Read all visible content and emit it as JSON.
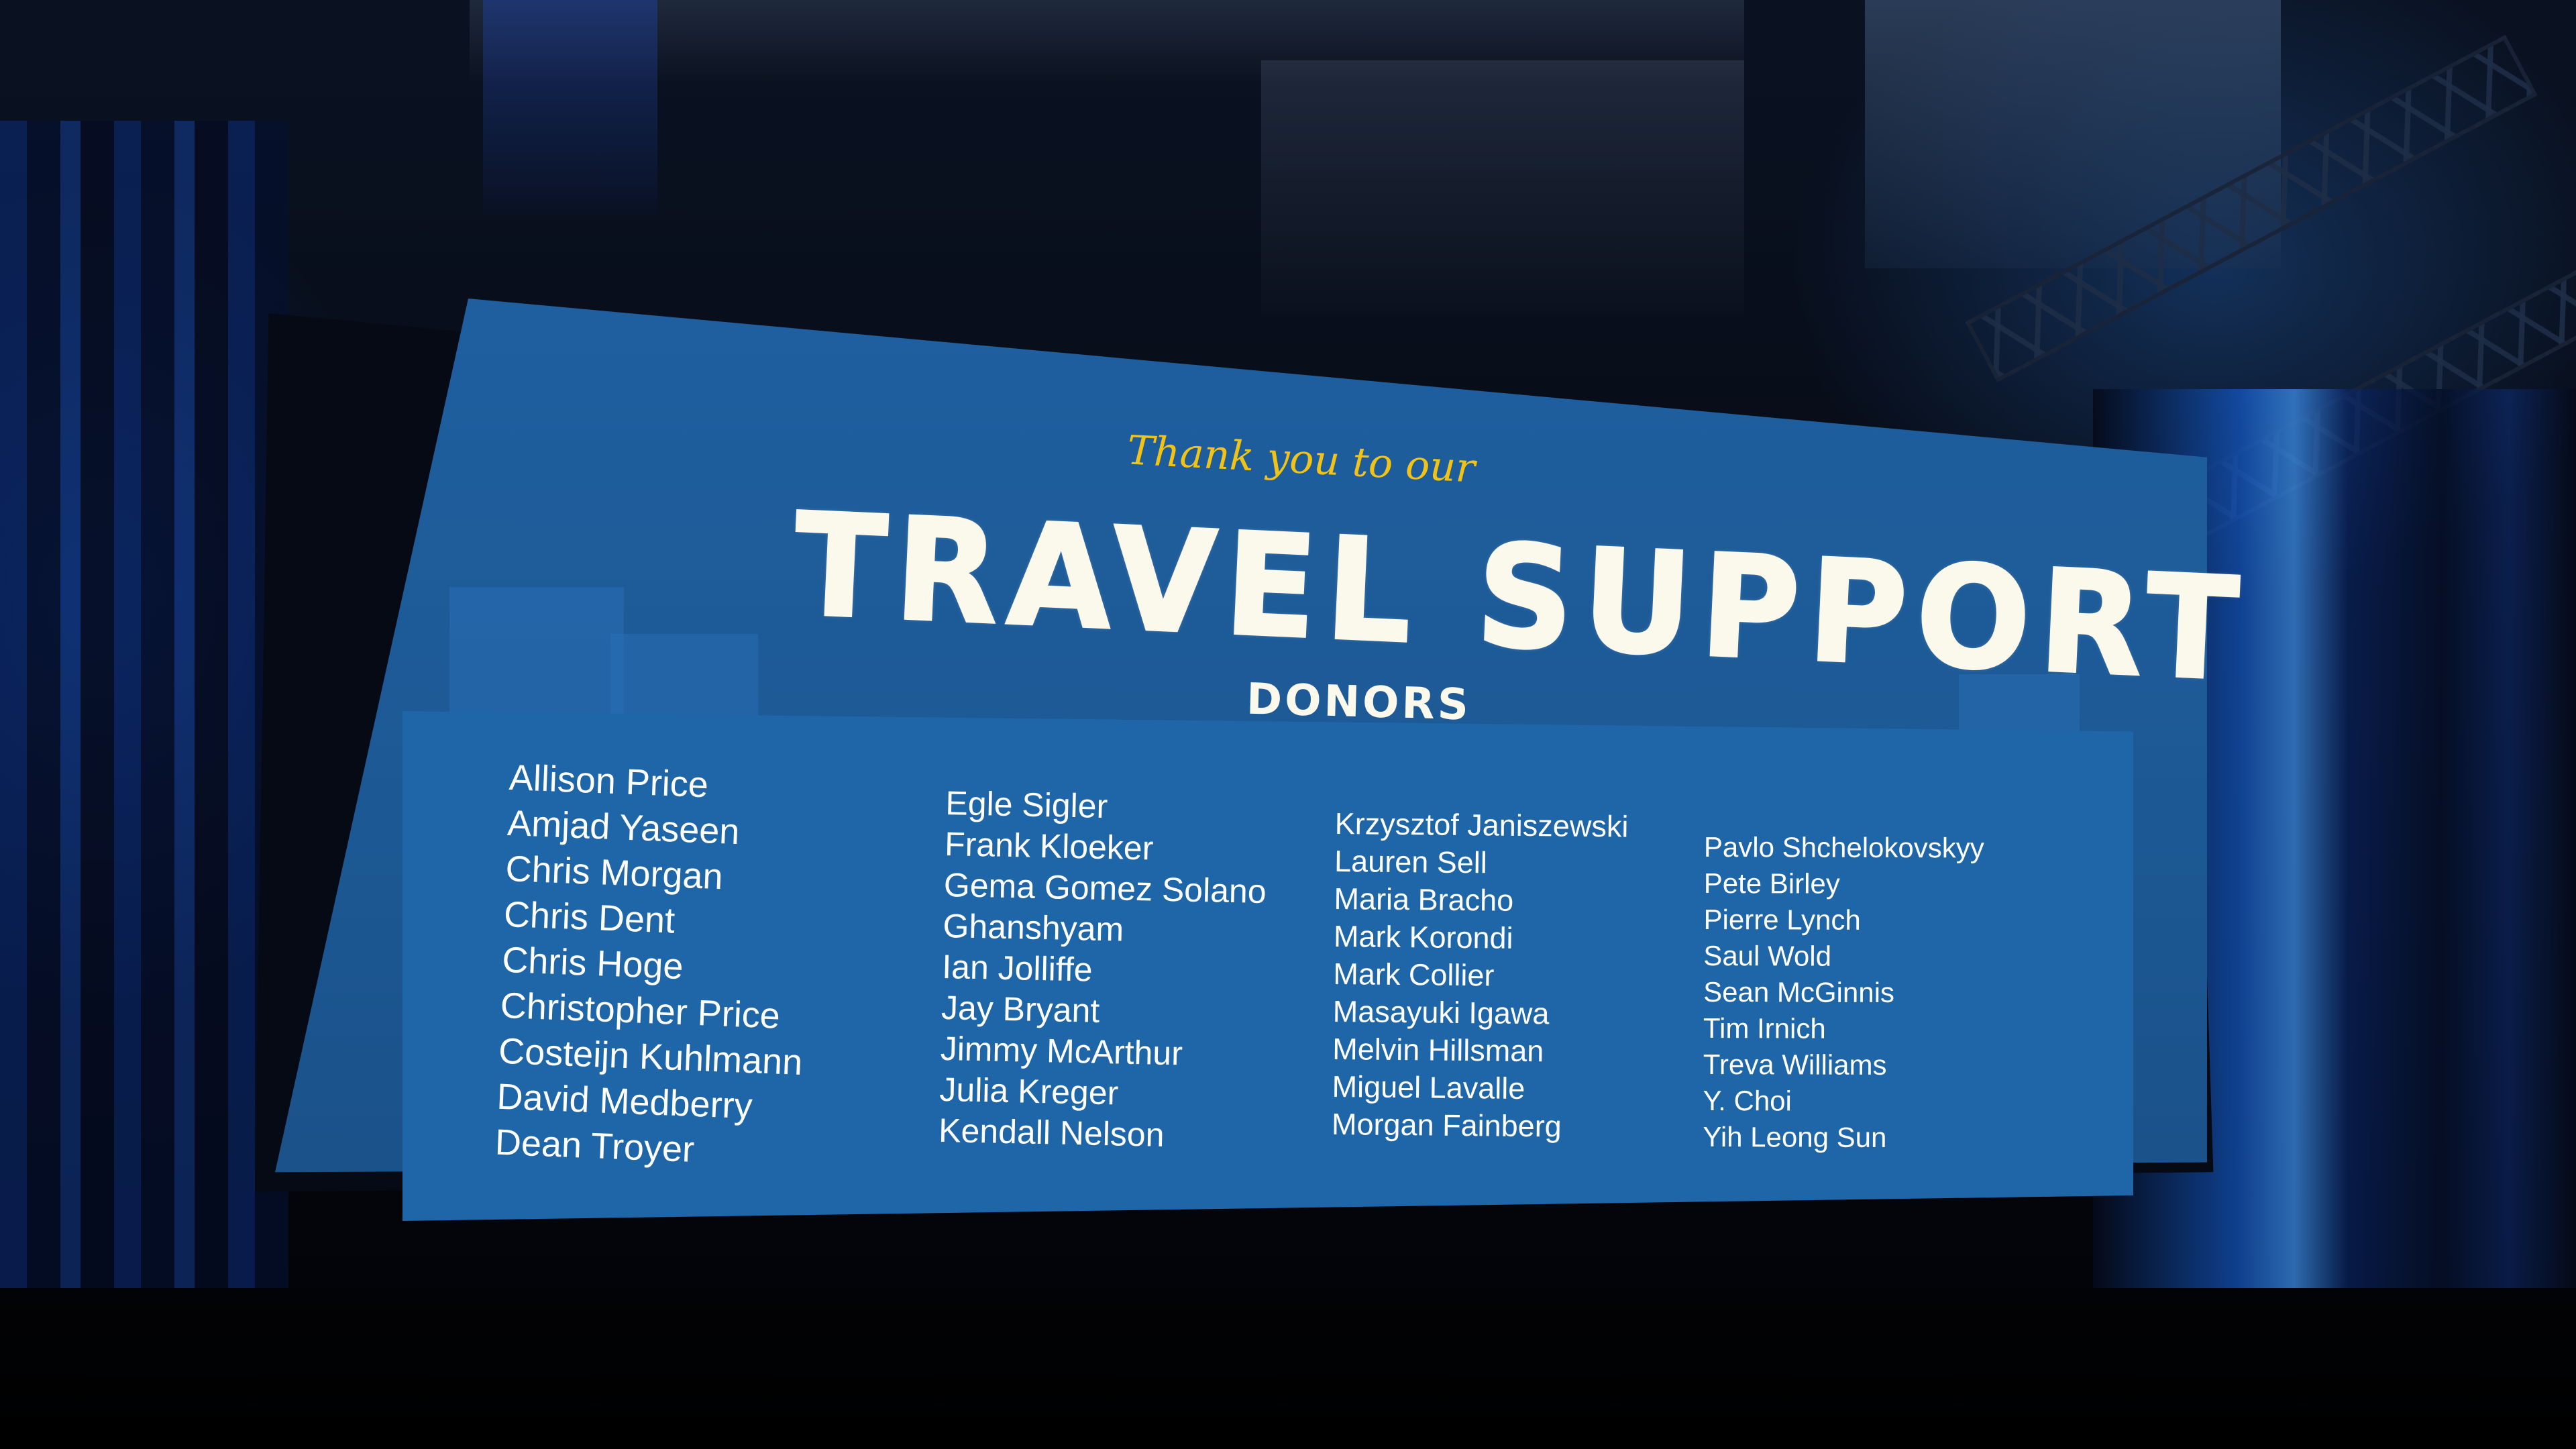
{
  "slide": {
    "greeting": "Thank you to our",
    "title": "TRAVEL SUPPORT",
    "subtitle": "DONORS",
    "columns": [
      [
        "Allison Price",
        "Amjad Yaseen",
        "Chris Morgan",
        "Chris Dent",
        "Chris Hoge",
        "Christopher Price",
        "Costeijn Kuhlmann",
        "David Medberry",
        "Dean Troyer"
      ],
      [
        "Egle Sigler",
        "Frank Kloeker",
        "Gema Gomez Solano",
        "Ghanshyam",
        "Ian Jolliffe",
        "Jay Bryant",
        "Jimmy McArthur",
        "Julia Kreger",
        "Kendall Nelson"
      ],
      [
        "Krzysztof Janiszewski",
        "Lauren Sell",
        "Maria Bracho",
        "Mark Korondi",
        "Mark Collier",
        "Masayuki Igawa",
        "Melvin Hillsman",
        "Miguel Lavalle",
        "Morgan Fainberg"
      ],
      [
        "Pavlo Shchelokovskyy",
        "Pete Birley",
        "Pierre Lynch",
        "Saul Wold",
        "Sean McGinnis",
        "Tim Irnich",
        "Treva Williams",
        "Y. Choi",
        "Yih Leong Sun"
      ]
    ]
  },
  "colors": {
    "slide_background": "#1f5fa0",
    "accent_yellow": "#f2c317",
    "title_text": "#fbf8ec",
    "name_text": "#ffffff"
  }
}
